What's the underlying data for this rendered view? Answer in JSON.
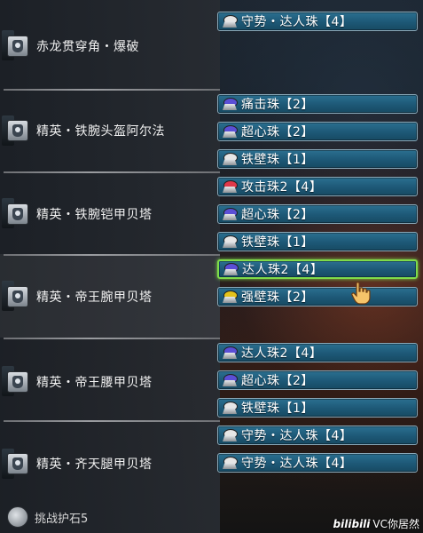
{
  "colors": {
    "slot_bg": "#1d5876",
    "slot_border": "#8aa8b8",
    "selected_border": "#7fdc4a",
    "gem_purple": "#5b4fd6",
    "gem_red": "#e0384a",
    "gem_yellow": "#e4c21a",
    "gem_white": "#e6e6e6"
  },
  "gear": [
    {
      "name": "赤龙贯穿角・爆破",
      "icon": "weapon-icon"
    },
    {
      "name": "精英・铁腕头盔阿尔法",
      "icon": "helmet-icon"
    },
    {
      "name": "精英・铁腕铠甲贝塔",
      "icon": "chest-armor-icon"
    },
    {
      "name": "精英・帝王腕甲贝塔",
      "icon": "arm-armor-icon"
    },
    {
      "name": "精英・帝王腰甲贝塔",
      "icon": "waist-armor-icon"
    },
    {
      "name": "精英・齐天腿甲贝塔",
      "icon": "leg-armor-icon"
    }
  ],
  "slots": [
    {
      "text": "守势・达人珠【4】",
      "gem": "white"
    },
    {
      "text": "痛击珠【2】",
      "gem": "purple"
    },
    {
      "text": "超心珠【2】",
      "gem": "purple"
    },
    {
      "text": "铁壁珠【1】",
      "gem": "white"
    },
    {
      "text": "攻击珠2【4】",
      "gem": "red"
    },
    {
      "text": "超心珠【2】",
      "gem": "purple"
    },
    {
      "text": "铁壁珠【1】",
      "gem": "white"
    },
    {
      "text": "达人珠2【4】",
      "gem": "purple"
    },
    {
      "text": "强壁珠【2】",
      "gem": "yellow"
    },
    {
      "text": "达人珠2【4】",
      "gem": "purple"
    },
    {
      "text": "超心珠【2】",
      "gem": "purple"
    },
    {
      "text": "铁壁珠【1】",
      "gem": "white"
    },
    {
      "text": "守势・达人珠【4】",
      "gem": "white"
    },
    {
      "text": "守势・达人珠【4】",
      "gem": "white"
    }
  ],
  "charm": {
    "name": "挑战护石5",
    "icon": "charm-icon"
  },
  "cursor": {
    "icon": "hand-pointer-icon"
  },
  "watermark": {
    "logo": "bilibili",
    "text": "VC你居然"
  }
}
